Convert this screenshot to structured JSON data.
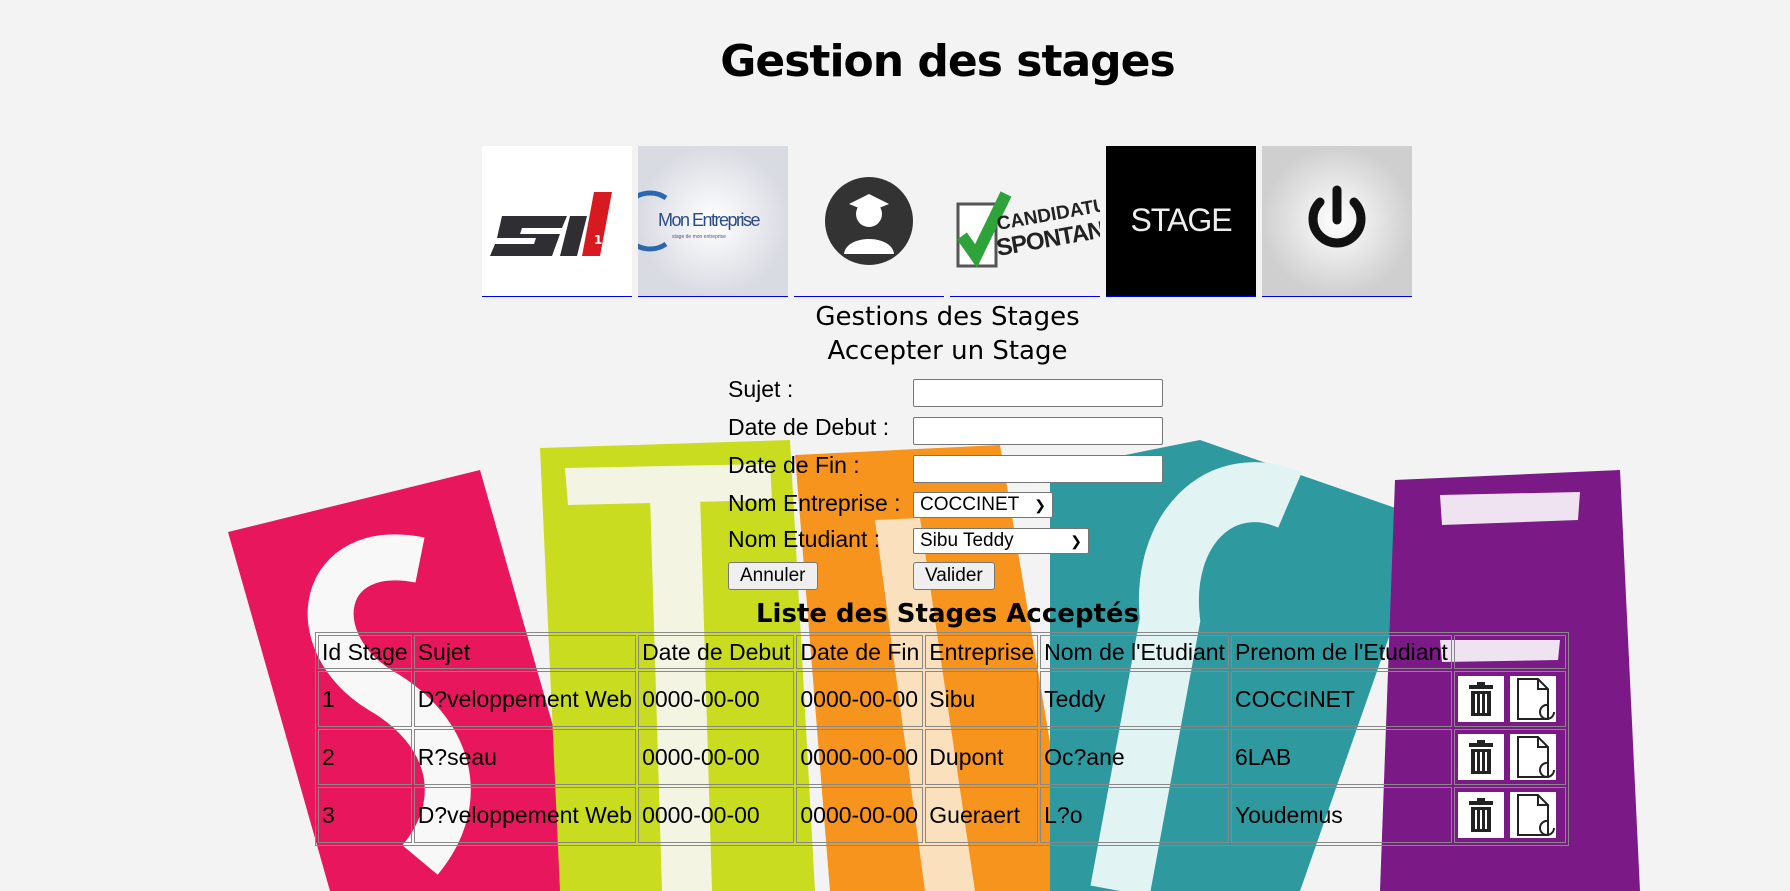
{
  "page": {
    "title": "Gestion des stages"
  },
  "nav": [
    {
      "name": "s1-logo",
      "alt": "SI STAGE"
    },
    {
      "name": "mon-entreprise-logo",
      "text": "Mon Entreprise",
      "small": "stage de mon entreprise"
    },
    {
      "name": "student-icon",
      "alt": "Etudiant"
    },
    {
      "name": "candidature-logo",
      "text1": "CANDIDATURE",
      "text2": "SPONTANÉE"
    },
    {
      "name": "stage-logo",
      "text": "STAGE"
    },
    {
      "name": "power-icon",
      "alt": "Deconnexion"
    }
  ],
  "section": {
    "title": "Gestions des Stages",
    "subtitle": "Accepter un Stage"
  },
  "form": {
    "sujet_label": "Sujet :",
    "sujet_value": "",
    "date_debut_label": "Date de Debut :",
    "date_debut_value": "",
    "date_fin_label": "Date de Fin :",
    "date_fin_value": "",
    "entreprise_label": "Nom Entreprise :",
    "entreprise_selected": "COCCINET",
    "etudiant_label": "Nom Etudiant :",
    "etudiant_selected": "Sibu Teddy",
    "cancel_label": "Annuler",
    "submit_label": "Valider"
  },
  "table": {
    "title": "Liste des Stages Acceptés",
    "headers": [
      "Id Stage",
      "Sujet",
      "Date de Debut",
      "Date de Fin",
      "Entreprise",
      "Nom de l'Etudiant",
      "Prenom de l'Etudiant"
    ],
    "rows": [
      [
        "1",
        "D?veloppement Web",
        "0000-00-00",
        "0000-00-00",
        "Sibu",
        "Teddy",
        "COCCINET"
      ],
      [
        "2",
        "R?seau",
        "0000-00-00",
        "0000-00-00",
        "Dupont",
        "Oc?ane",
        "6LAB"
      ],
      [
        "3",
        "D?veloppement Web",
        "0000-00-00",
        "0000-00-00",
        "Gueraert",
        "L?o",
        "Youdemus"
      ]
    ],
    "row_actions": [
      {
        "name": "delete-icon"
      },
      {
        "name": "edit-document-icon"
      }
    ]
  },
  "colors": {
    "bg_pink": "#e8175d",
    "bg_lime": "#c9dc1f",
    "bg_orange": "#f7941d",
    "bg_teal": "#2e9a9f",
    "bg_purple": "#7b1a87"
  }
}
